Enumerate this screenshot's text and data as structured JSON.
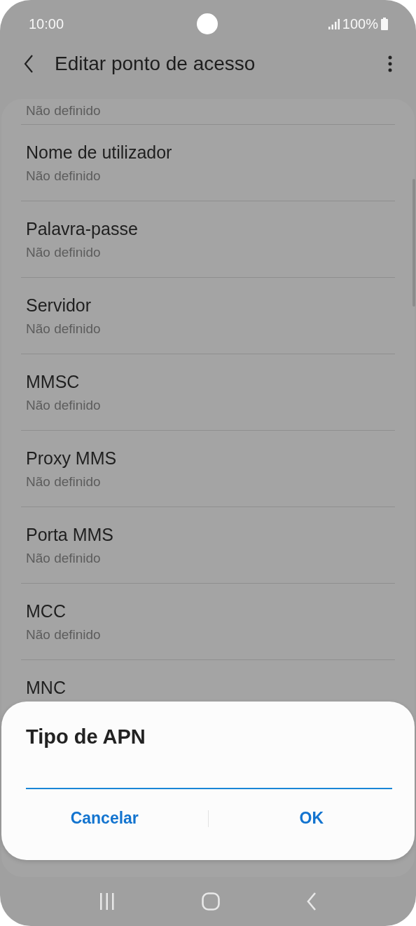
{
  "status_bar": {
    "time": "10:00",
    "battery": "100%"
  },
  "header": {
    "title": "Editar ponto de acesso"
  },
  "settings": [
    {
      "subtitle": "Não definido"
    },
    {
      "title": "Nome de utilizador",
      "subtitle": "Não definido"
    },
    {
      "title": "Palavra-passe",
      "subtitle": "Não definido"
    },
    {
      "title": "Servidor",
      "subtitle": "Não definido"
    },
    {
      "title": "MMSC",
      "subtitle": "Não definido"
    },
    {
      "title": "Proxy MMS",
      "subtitle": "Não definido"
    },
    {
      "title": "Porta MMS",
      "subtitle": "Não definido"
    },
    {
      "title": "MCC",
      "subtitle": "Não definido"
    },
    {
      "title": "MNC"
    }
  ],
  "dialog": {
    "title": "Tipo de APN",
    "buttons": [
      "Cancelar",
      "OK"
    ]
  }
}
